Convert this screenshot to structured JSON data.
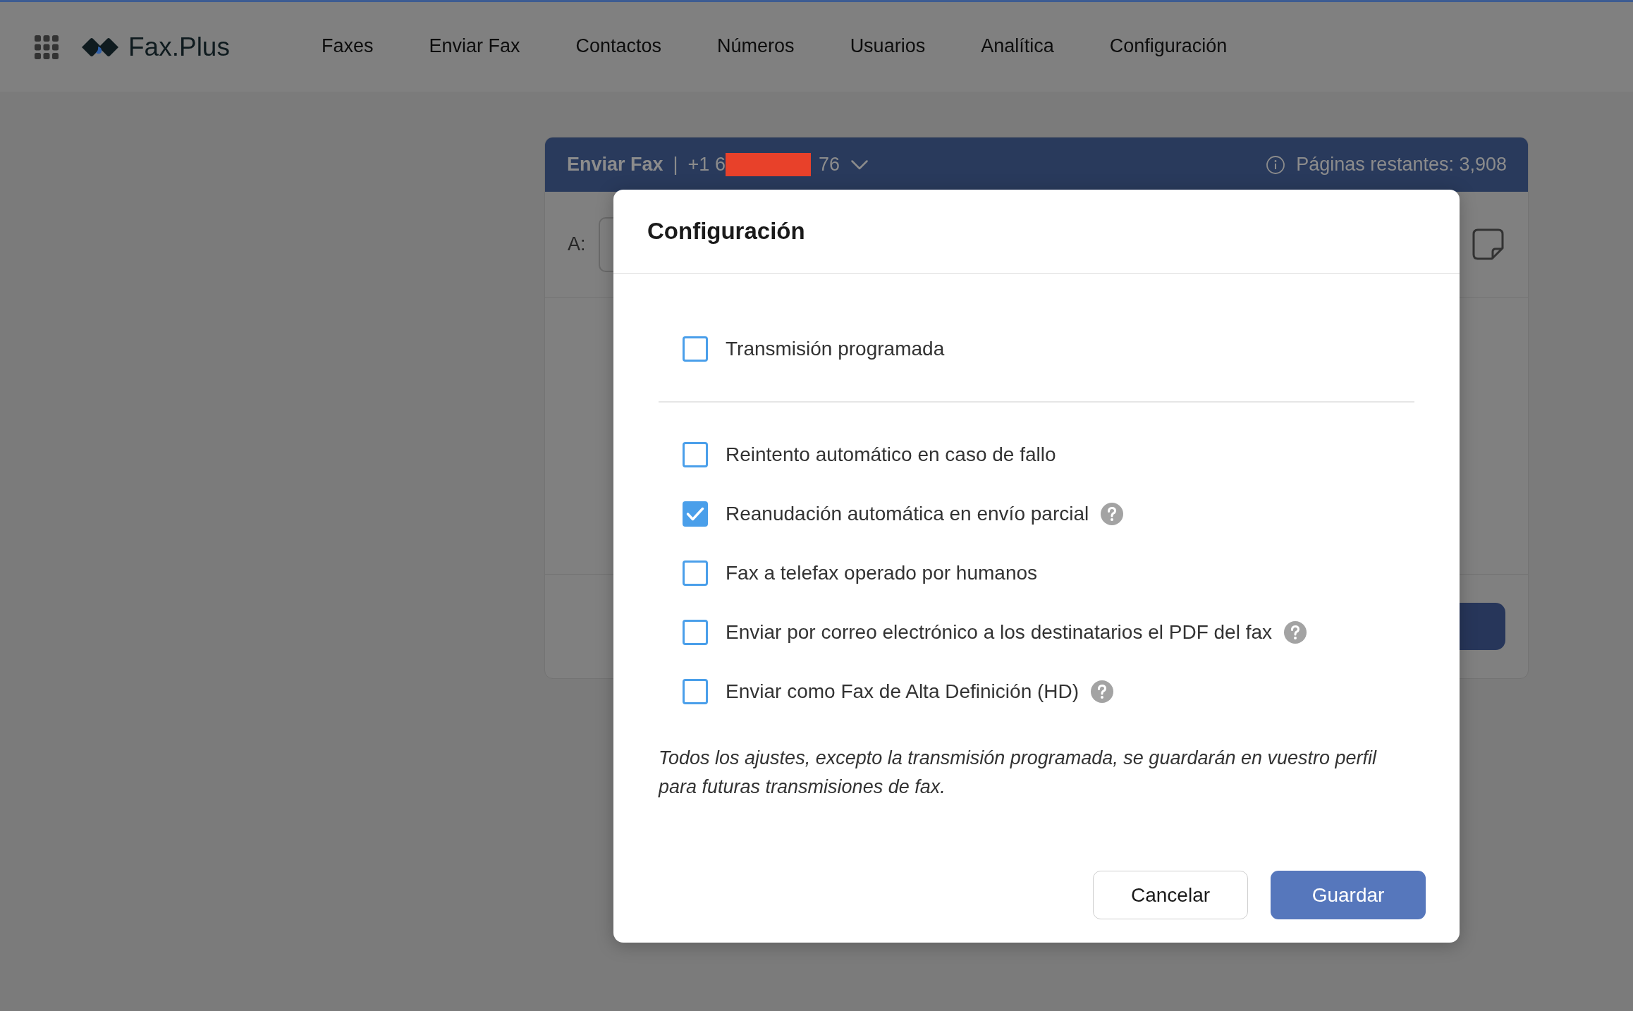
{
  "top_nav": {
    "logo_text": "Fax.Plus",
    "items": [
      {
        "label": "Faxes",
        "selected": false
      },
      {
        "label": "Enviar Fax",
        "selected": false
      },
      {
        "label": "Contactos",
        "selected": false
      },
      {
        "label": "Números",
        "selected": false
      },
      {
        "label": "Usuarios",
        "selected": false
      },
      {
        "label": "Analítica",
        "selected": false
      },
      {
        "label": "Configuración",
        "selected": false
      }
    ]
  },
  "send_fax_card": {
    "header": {
      "title": "Enviar Fax",
      "separator": "|",
      "number_start": "+1 6",
      "number_end": "76",
      "pages_remaining": "Páginas restantes: 3,908"
    },
    "recipient_label": "A:"
  },
  "settings_dialog": {
    "title": "Configuración",
    "option_groups": [
      {
        "options": [
          {
            "label": "Transmisión programada",
            "checked": false,
            "help": false
          }
        ]
      },
      {
        "options": [
          {
            "label": "Reintento automático en caso de fallo",
            "checked": false,
            "help": false
          },
          {
            "label": "Reanudación automática en envío parcial",
            "checked": true,
            "help": true
          },
          {
            "label": "Fax a telefax operado por humanos",
            "checked": false,
            "help": false
          },
          {
            "label": "Enviar por correo electrónico a los destinatarios el PDF del fax",
            "checked": false,
            "help": true
          },
          {
            "label": "Enviar como Fax de Alta Definición (HD)",
            "checked": false,
            "help": true
          }
        ]
      }
    ],
    "note": "Todos los ajustes, excepto la transmisión programada, se guardarán en vuestro perfil para futuras transmisiones de fax.",
    "buttons": [
      {
        "label": "Cancelar",
        "kind": "secondary"
      },
      {
        "label": "Guardar",
        "kind": "primary"
      }
    ]
  }
}
